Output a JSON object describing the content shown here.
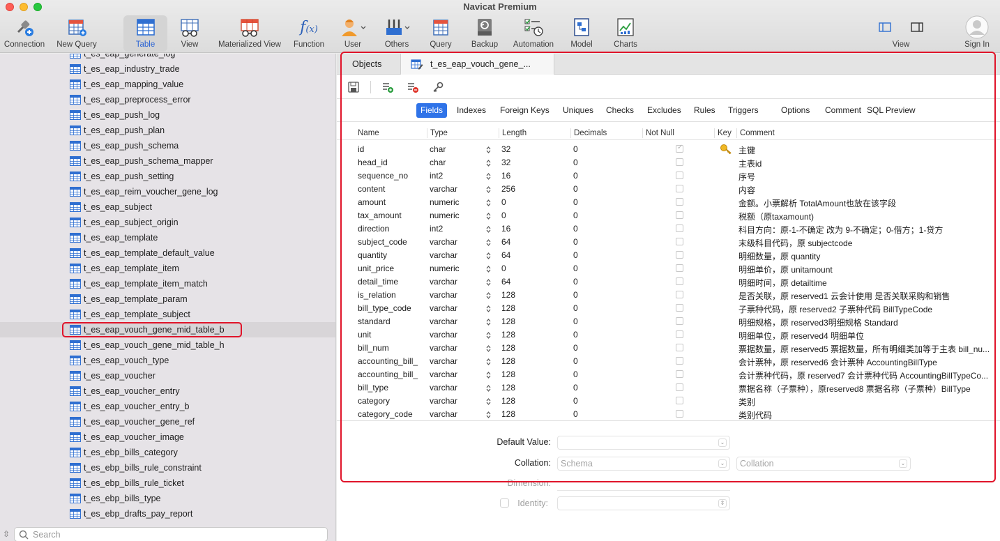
{
  "app": {
    "title": "Navicat Premium"
  },
  "toolbar": [
    {
      "label": "Connection",
      "icon": "connection-icon"
    },
    {
      "label": "New Query",
      "icon": "new-query-icon"
    },
    {
      "label": "Table",
      "icon": "table-icon",
      "active": true
    },
    {
      "label": "View",
      "icon": "view-icon"
    },
    {
      "label": "Materialized View",
      "icon": "materialized-view-icon"
    },
    {
      "label": "Function",
      "icon": "function-icon"
    },
    {
      "label": "User",
      "icon": "user-icon"
    },
    {
      "label": "Others",
      "icon": "others-icon"
    },
    {
      "label": "Query",
      "icon": "query-icon"
    },
    {
      "label": "Backup",
      "icon": "backup-icon"
    },
    {
      "label": "Automation",
      "icon": "automation-icon"
    },
    {
      "label": "Model",
      "icon": "model-icon"
    },
    {
      "label": "Charts",
      "icon": "charts-icon"
    }
  ],
  "toolbar_right": {
    "view_label": "View",
    "signin_label": "Sign In"
  },
  "sidebar": {
    "items": [
      "t_es_eap_generate_log",
      "t_es_eap_industry_trade",
      "t_es_eap_mapping_value",
      "t_es_eap_preprocess_error",
      "t_es_eap_push_log",
      "t_es_eap_push_plan",
      "t_es_eap_push_schema",
      "t_es_eap_push_schema_mapper",
      "t_es_eap_push_setting",
      "t_es_eap_reim_voucher_gene_log",
      "t_es_eap_subject",
      "t_es_eap_subject_origin",
      "t_es_eap_template",
      "t_es_eap_template_default_value",
      "t_es_eap_template_item",
      "t_es_eap_template_item_match",
      "t_es_eap_template_param",
      "t_es_eap_template_subject",
      "t_es_eap_vouch_gene_mid_table_b",
      "t_es_eap_vouch_gene_mid_table_h",
      "t_es_eap_vouch_type",
      "t_es_eap_voucher",
      "t_es_eap_voucher_entry",
      "t_es_eap_voucher_entry_b",
      "t_es_eap_voucher_gene_ref",
      "t_es_eap_voucher_image",
      "t_es_ebp_bills_category",
      "t_es_ebp_bills_rule_constraint",
      "t_es_ebp_bills_rule_ticket",
      "t_es_ebp_bills_type",
      "t_es_ebp_drafts_pay_report"
    ],
    "selected_index": 18,
    "search_placeholder": "Search"
  },
  "tabs": [
    {
      "label": "Objects"
    },
    {
      "label": "t_es_eap_vouch_gene_..."
    }
  ],
  "subtabs": [
    "Fields",
    "Indexes",
    "Foreign Keys",
    "Uniques",
    "Checks",
    "Excludes",
    "Rules",
    "Triggers",
    "Options",
    "Comment",
    "SQL Preview"
  ],
  "columns": [
    "Name",
    "Type",
    "Length",
    "Decimals",
    "Not Null",
    "Key",
    "Comment"
  ],
  "fields": [
    {
      "name": "id",
      "type": "char",
      "length": "32",
      "decimals": "0",
      "not_null": true,
      "key": true,
      "comment": "主键"
    },
    {
      "name": "head_id",
      "type": "char",
      "length": "32",
      "decimals": "0",
      "not_null": false,
      "key": false,
      "comment": "主表id"
    },
    {
      "name": "sequence_no",
      "type": "int2",
      "length": "16",
      "decimals": "0",
      "not_null": false,
      "key": false,
      "comment": "序号"
    },
    {
      "name": "content",
      "type": "varchar",
      "length": "256",
      "decimals": "0",
      "not_null": false,
      "key": false,
      "comment": "内容"
    },
    {
      "name": "amount",
      "type": "numeric",
      "length": "0",
      "decimals": "0",
      "not_null": false,
      "key": false,
      "comment": "金额。小票解析 TotalAmount也放在该字段"
    },
    {
      "name": "tax_amount",
      "type": "numeric",
      "length": "0",
      "decimals": "0",
      "not_null": false,
      "key": false,
      "comment": "税额（原taxamount)"
    },
    {
      "name": "direction",
      "type": "int2",
      "length": "16",
      "decimals": "0",
      "not_null": false,
      "key": false,
      "comment": "科目方向：原-1-不确定 改为 9-不确定；0-借方；1-贷方"
    },
    {
      "name": "subject_code",
      "type": "varchar",
      "length": "64",
      "decimals": "0",
      "not_null": false,
      "key": false,
      "comment": "末级科目代码，原 subjectcode"
    },
    {
      "name": "quantity",
      "type": "varchar",
      "length": "64",
      "decimals": "0",
      "not_null": false,
      "key": false,
      "comment": "明细数量，原 quantity"
    },
    {
      "name": "unit_price",
      "type": "numeric",
      "length": "0",
      "decimals": "0",
      "not_null": false,
      "key": false,
      "comment": "明细单价，原 unitamount"
    },
    {
      "name": "detail_time",
      "type": "varchar",
      "length": "64",
      "decimals": "0",
      "not_null": false,
      "key": false,
      "comment": "明细时间，原 detailtime"
    },
    {
      "name": "is_relation",
      "type": "varchar",
      "length": "128",
      "decimals": "0",
      "not_null": false,
      "key": false,
      "comment": "是否关联，原 reserved1 云会计使用 是否关联采购和销售"
    },
    {
      "name": "bill_type_code",
      "type": "varchar",
      "length": "128",
      "decimals": "0",
      "not_null": false,
      "key": false,
      "comment": "子票种代码，原 reserved2 子票种代码 BillTypeCode"
    },
    {
      "name": "standard",
      "type": "varchar",
      "length": "128",
      "decimals": "0",
      "not_null": false,
      "key": false,
      "comment": "明细规格，原 reserved3明细规格 Standard"
    },
    {
      "name": "unit",
      "type": "varchar",
      "length": "128",
      "decimals": "0",
      "not_null": false,
      "key": false,
      "comment": "明细单位，原 reserved4 明细单位"
    },
    {
      "name": "bill_num",
      "type": "varchar",
      "length": "128",
      "decimals": "0",
      "not_null": false,
      "key": false,
      "comment": "票据数量，原 reserved5 票据数量，所有明细类加等于主表 bill_nu..."
    },
    {
      "name": "accounting_bill_",
      "type": "varchar",
      "length": "128",
      "decimals": "0",
      "not_null": false,
      "key": false,
      "comment": "会计票种，原 reserved6 会计票种 AccountingBillType"
    },
    {
      "name": "accounting_bill_",
      "type": "varchar",
      "length": "128",
      "decimals": "0",
      "not_null": false,
      "key": false,
      "comment": "会计票种代码，原 reserved7 会计票种代码 AccountingBillTypeCo..."
    },
    {
      "name": "bill_type",
      "type": "varchar",
      "length": "128",
      "decimals": "0",
      "not_null": false,
      "key": false,
      "comment": "票据名称（子票种），原reserved8 票据名称（子票种）BillType"
    },
    {
      "name": "category",
      "type": "varchar",
      "length": "128",
      "decimals": "0",
      "not_null": false,
      "key": false,
      "comment": "类别"
    },
    {
      "name": "category_code",
      "type": "varchar",
      "length": "128",
      "decimals": "0",
      "not_null": false,
      "key": false,
      "comment": "类别代码"
    }
  ],
  "properties": {
    "default_value_label": "Default Value:",
    "collation_label": "Collation:",
    "collation_schema_placeholder": "Schema",
    "collation_placeholder": "Collation",
    "dimension_label": "Dimension:",
    "identity_label": "Identity:"
  }
}
